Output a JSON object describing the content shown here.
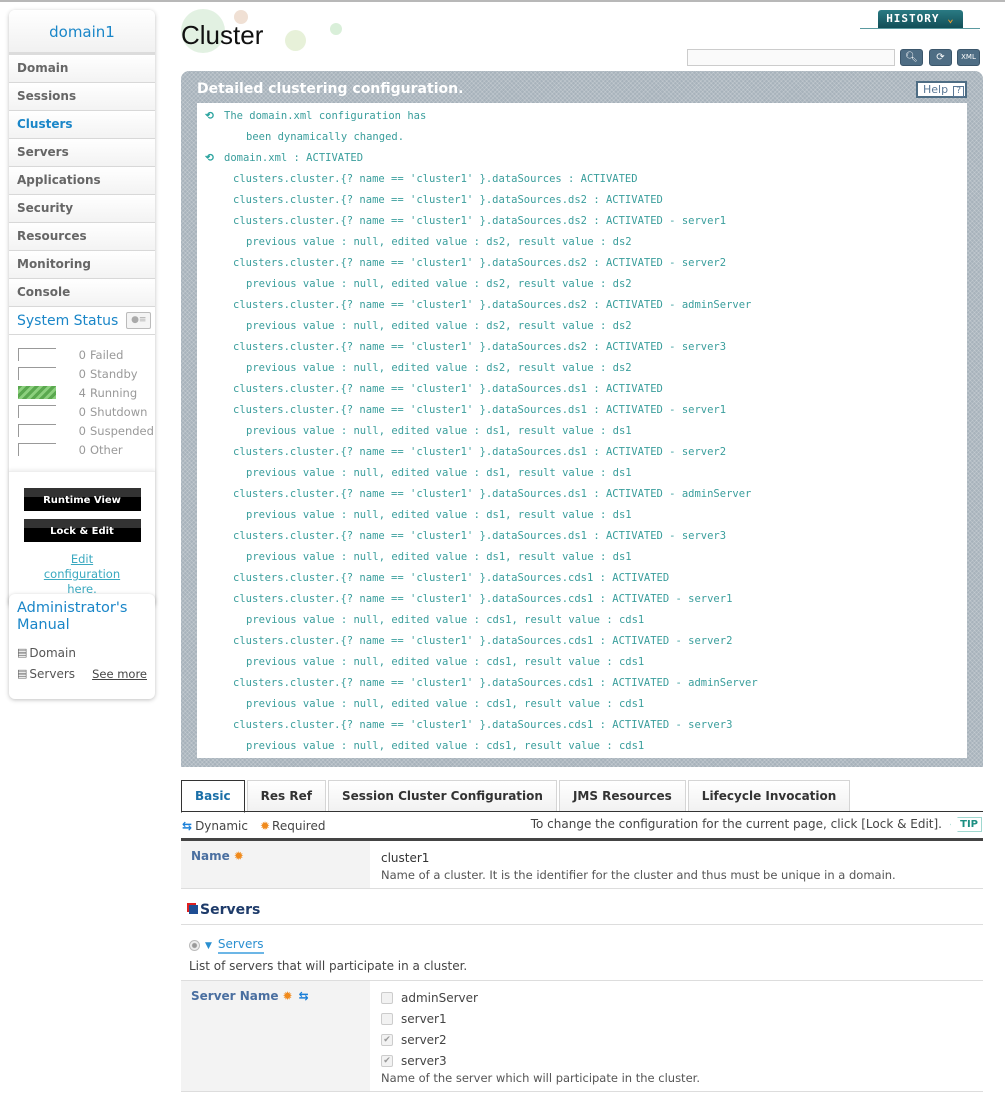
{
  "sidebar": {
    "domain_name": "domain1",
    "items": [
      {
        "label": "Domain"
      },
      {
        "label": "Sessions"
      },
      {
        "label": "Clusters",
        "active": true
      },
      {
        "label": "Servers"
      },
      {
        "label": "Applications"
      },
      {
        "label": "Security"
      },
      {
        "label": "Resources"
      },
      {
        "label": "Monitoring"
      },
      {
        "label": "Console"
      }
    ],
    "system_status": {
      "title": "System Status",
      "rows": [
        {
          "count": "0",
          "label": "Failed"
        },
        {
          "count": "0",
          "label": "Standby"
        },
        {
          "count": "4",
          "label": "Running"
        },
        {
          "count": "0",
          "label": "Shutdown"
        },
        {
          "count": "0",
          "label": "Suspended"
        },
        {
          "count": "0",
          "label": "Other"
        }
      ]
    },
    "runtime_view_label": "Runtime View",
    "lock_edit_label": "Lock & Edit",
    "edit_config_link": "Edit configuration here."
  },
  "manual": {
    "title": "Administrator's Manual",
    "links": [
      "Domain",
      "Servers"
    ],
    "see_more": "See more"
  },
  "header": {
    "title": "Cluster",
    "history_label": "HISTORY",
    "search_value": "",
    "colors": {
      "accent": "#1a86c8",
      "log_text": "#3a9e9c",
      "history_bg": "#1d636c"
    }
  },
  "log": {
    "title": "Detailed clustering configuration.",
    "help_label": "Help",
    "lines": [
      {
        "type": "head",
        "text": "The domain.xml configuration has"
      },
      {
        "type": "wrap",
        "text": "been dynamically changed."
      },
      {
        "type": "head",
        "text": "domain.xml : ACTIVATED"
      },
      {
        "type": "l1",
        "text": "clusters.cluster.{? name == 'cluster1' }.dataSources : ACTIVATED"
      },
      {
        "type": "l1",
        "text": "clusters.cluster.{? name == 'cluster1' }.dataSources.ds2 : ACTIVATED"
      },
      {
        "type": "l1",
        "text": "clusters.cluster.{? name == 'cluster1' }.dataSources.ds2 : ACTIVATED - server1"
      },
      {
        "type": "l2",
        "text": "previous value : null, edited value : ds2, result value : ds2"
      },
      {
        "type": "l1",
        "text": "clusters.cluster.{? name == 'cluster1' }.dataSources.ds2 : ACTIVATED - server2"
      },
      {
        "type": "l2",
        "text": "previous value : null, edited value : ds2, result value : ds2"
      },
      {
        "type": "l1",
        "text": "clusters.cluster.{? name == 'cluster1' }.dataSources.ds2 : ACTIVATED - adminServer"
      },
      {
        "type": "l2",
        "text": "previous value : null, edited value : ds2, result value : ds2"
      },
      {
        "type": "l1",
        "text": "clusters.cluster.{? name == 'cluster1' }.dataSources.ds2 : ACTIVATED - server3"
      },
      {
        "type": "l2",
        "text": "previous value : null, edited value : ds2, result value : ds2"
      },
      {
        "type": "l1",
        "text": "clusters.cluster.{? name == 'cluster1' }.dataSources.ds1 : ACTIVATED"
      },
      {
        "type": "l1",
        "text": "clusters.cluster.{? name == 'cluster1' }.dataSources.ds1 : ACTIVATED - server1"
      },
      {
        "type": "l2",
        "text": "previous value : null, edited value : ds1, result value : ds1"
      },
      {
        "type": "l1",
        "text": "clusters.cluster.{? name == 'cluster1' }.dataSources.ds1 : ACTIVATED - server2"
      },
      {
        "type": "l2",
        "text": "previous value : null, edited value : ds1, result value : ds1"
      },
      {
        "type": "l1",
        "text": "clusters.cluster.{? name == 'cluster1' }.dataSources.ds1 : ACTIVATED - adminServer"
      },
      {
        "type": "l2",
        "text": "previous value : null, edited value : ds1, result value : ds1"
      },
      {
        "type": "l1",
        "text": "clusters.cluster.{? name == 'cluster1' }.dataSources.ds1 : ACTIVATED - server3"
      },
      {
        "type": "l2",
        "text": "previous value : null, edited value : ds1, result value : ds1"
      },
      {
        "type": "l1",
        "text": "clusters.cluster.{? name == 'cluster1' }.dataSources.cds1 : ACTIVATED"
      },
      {
        "type": "l1",
        "text": "clusters.cluster.{? name == 'cluster1' }.dataSources.cds1 : ACTIVATED - server1"
      },
      {
        "type": "l2",
        "text": "previous value : null, edited value : cds1, result value : cds1"
      },
      {
        "type": "l1",
        "text": "clusters.cluster.{? name == 'cluster1' }.dataSources.cds1 : ACTIVATED - server2"
      },
      {
        "type": "l2",
        "text": "previous value : null, edited value : cds1, result value : cds1"
      },
      {
        "type": "l1",
        "text": "clusters.cluster.{? name == 'cluster1' }.dataSources.cds1 : ACTIVATED - adminServer"
      },
      {
        "type": "l2",
        "text": "previous value : null, edited value : cds1, result value : cds1"
      },
      {
        "type": "l1",
        "text": "clusters.cluster.{? name == 'cluster1' }.dataSources.cds1 : ACTIVATED - server3"
      },
      {
        "type": "l2",
        "text": "previous value : null, edited value : cds1, result value : cds1"
      }
    ]
  },
  "tabs": [
    {
      "label": "Basic",
      "active": true
    },
    {
      "label": "Res Ref"
    },
    {
      "label": "Session Cluster Configuration"
    },
    {
      "label": "JMS Resources"
    },
    {
      "label": "Lifecycle Invocation"
    }
  ],
  "legend": {
    "dynamic": "Dynamic",
    "required": "Required"
  },
  "tip": {
    "text": "To change the configuration for the current page, click [Lock & Edit].",
    "badge": "TIP"
  },
  "form": {
    "name": {
      "label": "Name",
      "value": "cluster1",
      "description": "Name of a cluster. It is the identifier for the cluster and thus must be unique in a domain."
    },
    "section_title": "Servers",
    "servers_link": "Servers",
    "servers_description": "List of servers that will participate in a cluster.",
    "server_name": {
      "label": "Server Name",
      "options": [
        {
          "label": "adminServer",
          "checked": false
        },
        {
          "label": "server1",
          "checked": false
        },
        {
          "label": "server2",
          "checked": true
        },
        {
          "label": "server3",
          "checked": true
        }
      ],
      "description": "Name of the server which will participate in the cluster."
    }
  }
}
